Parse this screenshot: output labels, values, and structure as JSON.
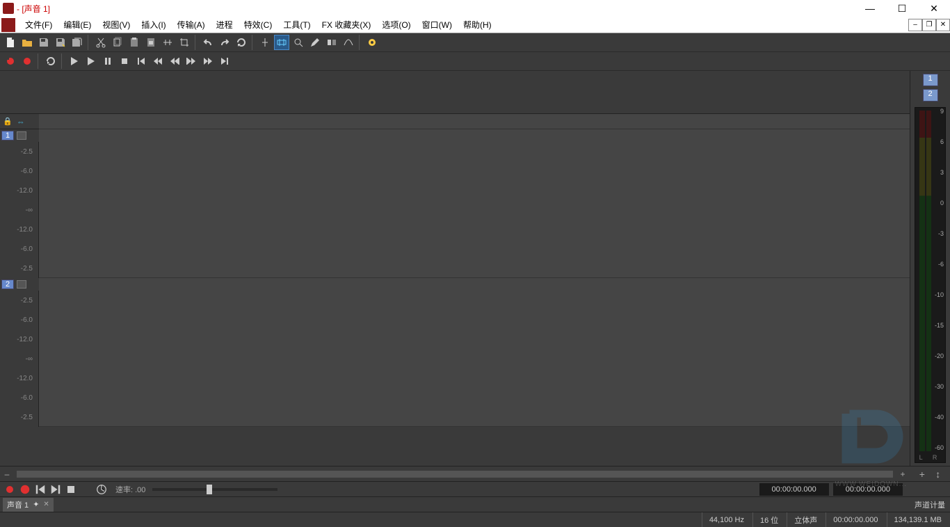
{
  "window": {
    "title": " - [声音 1]"
  },
  "menu": {
    "file": "文件(F)",
    "edit": "编辑(E)",
    "view": "视图(V)",
    "insert": "插入(I)",
    "transport": "传输(A)",
    "process": "进程",
    "effect": "特效(C)",
    "tools": "工具(T)",
    "fx": "FX 收藏夹(X)",
    "options": "选项(O)",
    "window": "窗口(W)",
    "help": "帮助(H)"
  },
  "db_labels": [
    "-2.5",
    "-6.0",
    "-12.0",
    "-∞",
    "-12.0",
    "-6.0",
    "-2.5"
  ],
  "tracks": [
    {
      "num": "1"
    },
    {
      "num": "2"
    }
  ],
  "meter": {
    "channels": [
      "1",
      "2"
    ],
    "scale": [
      "9",
      "6",
      "3",
      "0",
      "-3",
      "-6",
      "-10",
      "-15",
      "-20",
      "-30",
      "-40",
      "-60"
    ],
    "lr": "L  R",
    "label": "声道计量"
  },
  "mini": {
    "rate_label": "速率:",
    "rate_value": ".00",
    "time1": "00:00:00.000",
    "time2": "00:00:00.000"
  },
  "doc_tab": {
    "label": "声音 1",
    "pin": "✦",
    "close": "✕"
  },
  "status": {
    "sample_rate": "44,100 Hz",
    "bit_depth": "16 位",
    "channels": "立体声",
    "time": "00:00:00.000",
    "memory": "134,139.1 MB"
  },
  "watermark": "WWW.WEIDOWN..."
}
